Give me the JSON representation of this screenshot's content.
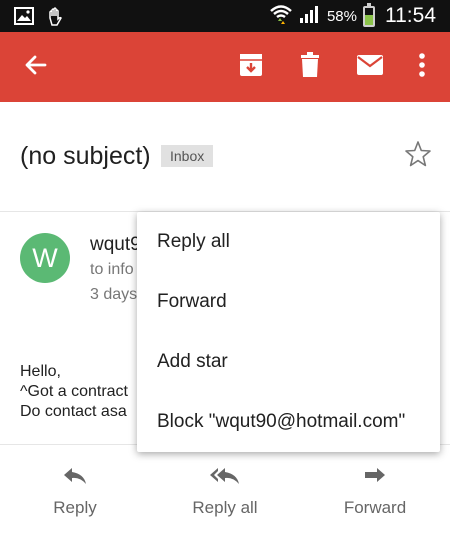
{
  "status_bar": {
    "battery_percent": "58%",
    "battery_level": 0.58,
    "time": "11:54",
    "icons": [
      "image-icon",
      "hand-icon",
      "wifi-icon",
      "signal-icon",
      "battery-icon"
    ]
  },
  "toolbar": {
    "icons": [
      "back-arrow-icon",
      "archive-icon",
      "trash-icon",
      "mail-icon",
      "more-vert-icon"
    ],
    "accent_color": "#db4437"
  },
  "email": {
    "subject": "(no subject)",
    "label": "Inbox",
    "avatar_letter": "W",
    "sender_name": "wqut9",
    "recipient": "to info",
    "date": "3 days",
    "body_lines": [
      "Hello,",
      "^Got a contract",
      "Do contact asa"
    ]
  },
  "bottom_actions": {
    "reply": "Reply",
    "reply_all": "Reply all",
    "forward": "Forward"
  },
  "menu": {
    "items": [
      "Reply all",
      "Forward",
      "Add star",
      "Block \"wqut90@hotmail.com\""
    ]
  }
}
